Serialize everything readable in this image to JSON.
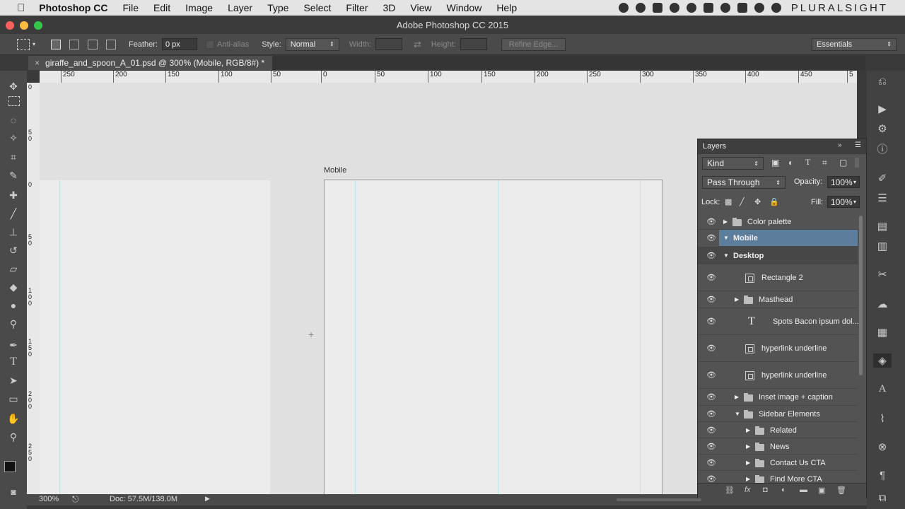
{
  "menubar": {
    "apple": "",
    "app": "Photoshop CC",
    "items": [
      "File",
      "Edit",
      "Image",
      "Layer",
      "Type",
      "Select",
      "Filter",
      "3D",
      "View",
      "Window",
      "Help"
    ],
    "brand": "PLURALSIGHT"
  },
  "window": {
    "title": "Adobe Photoshop CC 2015"
  },
  "options": {
    "feather_label": "Feather:",
    "feather_value": "0 px",
    "antialias_label": "Anti-alias",
    "style_label": "Style:",
    "style_value": "Normal",
    "width_label": "Width:",
    "height_label": "Height:",
    "refine_label": "Refine Edge...",
    "workspace": "Essentials"
  },
  "document": {
    "tab_title": "giraffe_and_spoon_A_01.psd @ 300% (Mobile, RGB/8#) *"
  },
  "ruler": {
    "h_ticks": [
      "250",
      "200",
      "150",
      "100",
      "50",
      "0",
      "50",
      "100",
      "150",
      "200",
      "250",
      "300",
      "350",
      "400",
      "450",
      "5"
    ],
    "v_ticks": [
      "0",
      "5 0",
      "0",
      "5 0",
      "1 0 0",
      "1 5 0",
      "2 0 0",
      "2 5 0"
    ]
  },
  "canvas": {
    "artboard_label": "Mobile"
  },
  "status": {
    "zoom": "300%",
    "doc": "Doc: 57.5M/138.0M"
  },
  "layers": {
    "title": "Layers",
    "filter_kind": "Kind",
    "blend_mode": "Pass Through",
    "opacity_label": "Opacity:",
    "opacity_value": "100%",
    "lock_label": "Lock:",
    "fill_label": "Fill:",
    "fill_value": "100%",
    "rows": [
      {
        "name": "Color palette",
        "type": "folder",
        "level": 0,
        "expanded": false
      },
      {
        "name": "Mobile",
        "type": "artboard",
        "level": 0,
        "expanded": true,
        "selected": true
      },
      {
        "name": "Desktop",
        "type": "artboard",
        "level": 0,
        "expanded": true
      },
      {
        "name": "Rectangle 2",
        "type": "shape",
        "level": 1
      },
      {
        "name": "Masthead",
        "type": "folder",
        "level": 1,
        "expanded": false
      },
      {
        "name": "Spots Bacon ipsum dol...",
        "type": "text",
        "level": 1
      },
      {
        "name": "hyperlink underline",
        "type": "shape",
        "level": 1
      },
      {
        "name": "hyperlink underline",
        "type": "shape",
        "level": 1
      },
      {
        "name": "Inset image + caption",
        "type": "folder",
        "level": 1,
        "expanded": false
      },
      {
        "name": "Sidebar Elements",
        "type": "folder",
        "level": 1,
        "expanded": true
      },
      {
        "name": "Related",
        "type": "folder",
        "level": 2,
        "expanded": false
      },
      {
        "name": "News",
        "type": "folder",
        "level": 2,
        "expanded": false
      },
      {
        "name": "Contact Us CTA",
        "type": "folder",
        "level": 2,
        "expanded": false
      },
      {
        "name": "Find More CTA",
        "type": "folder",
        "level": 2,
        "expanded": false
      }
    ]
  },
  "colors": {
    "layer_selected": "#5d7d9c",
    "canvas_bg": "#e0e0e0",
    "artboard": "#ececec",
    "guide": "#bfe3e3"
  }
}
